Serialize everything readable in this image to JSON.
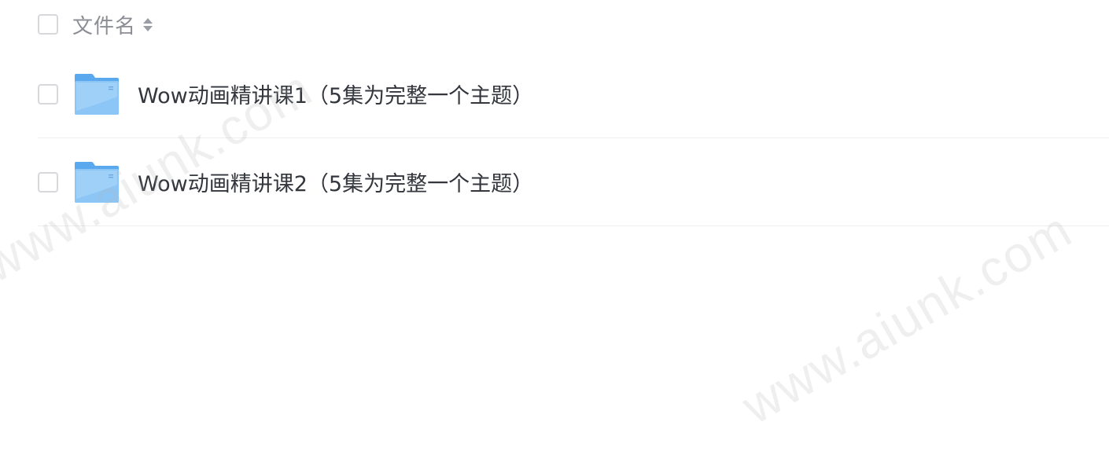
{
  "header": {
    "column_label": "文件名",
    "sort_icon": "sort-icon"
  },
  "files": [
    {
      "name": "Wow动画精讲课1（5集为完整一个主题）",
      "icon": "folder-icon"
    },
    {
      "name": "Wow动画精讲课2（5集为完整一个主题）",
      "icon": "folder-icon"
    }
  ],
  "watermarks": [
    "www.aiunk.com",
    "www.aiunk.com"
  ],
  "colors": {
    "folder_blue": "#6fb3f2",
    "text": "#33363c",
    "header_text": "#8a8d93",
    "divider": "#eceef1"
  }
}
